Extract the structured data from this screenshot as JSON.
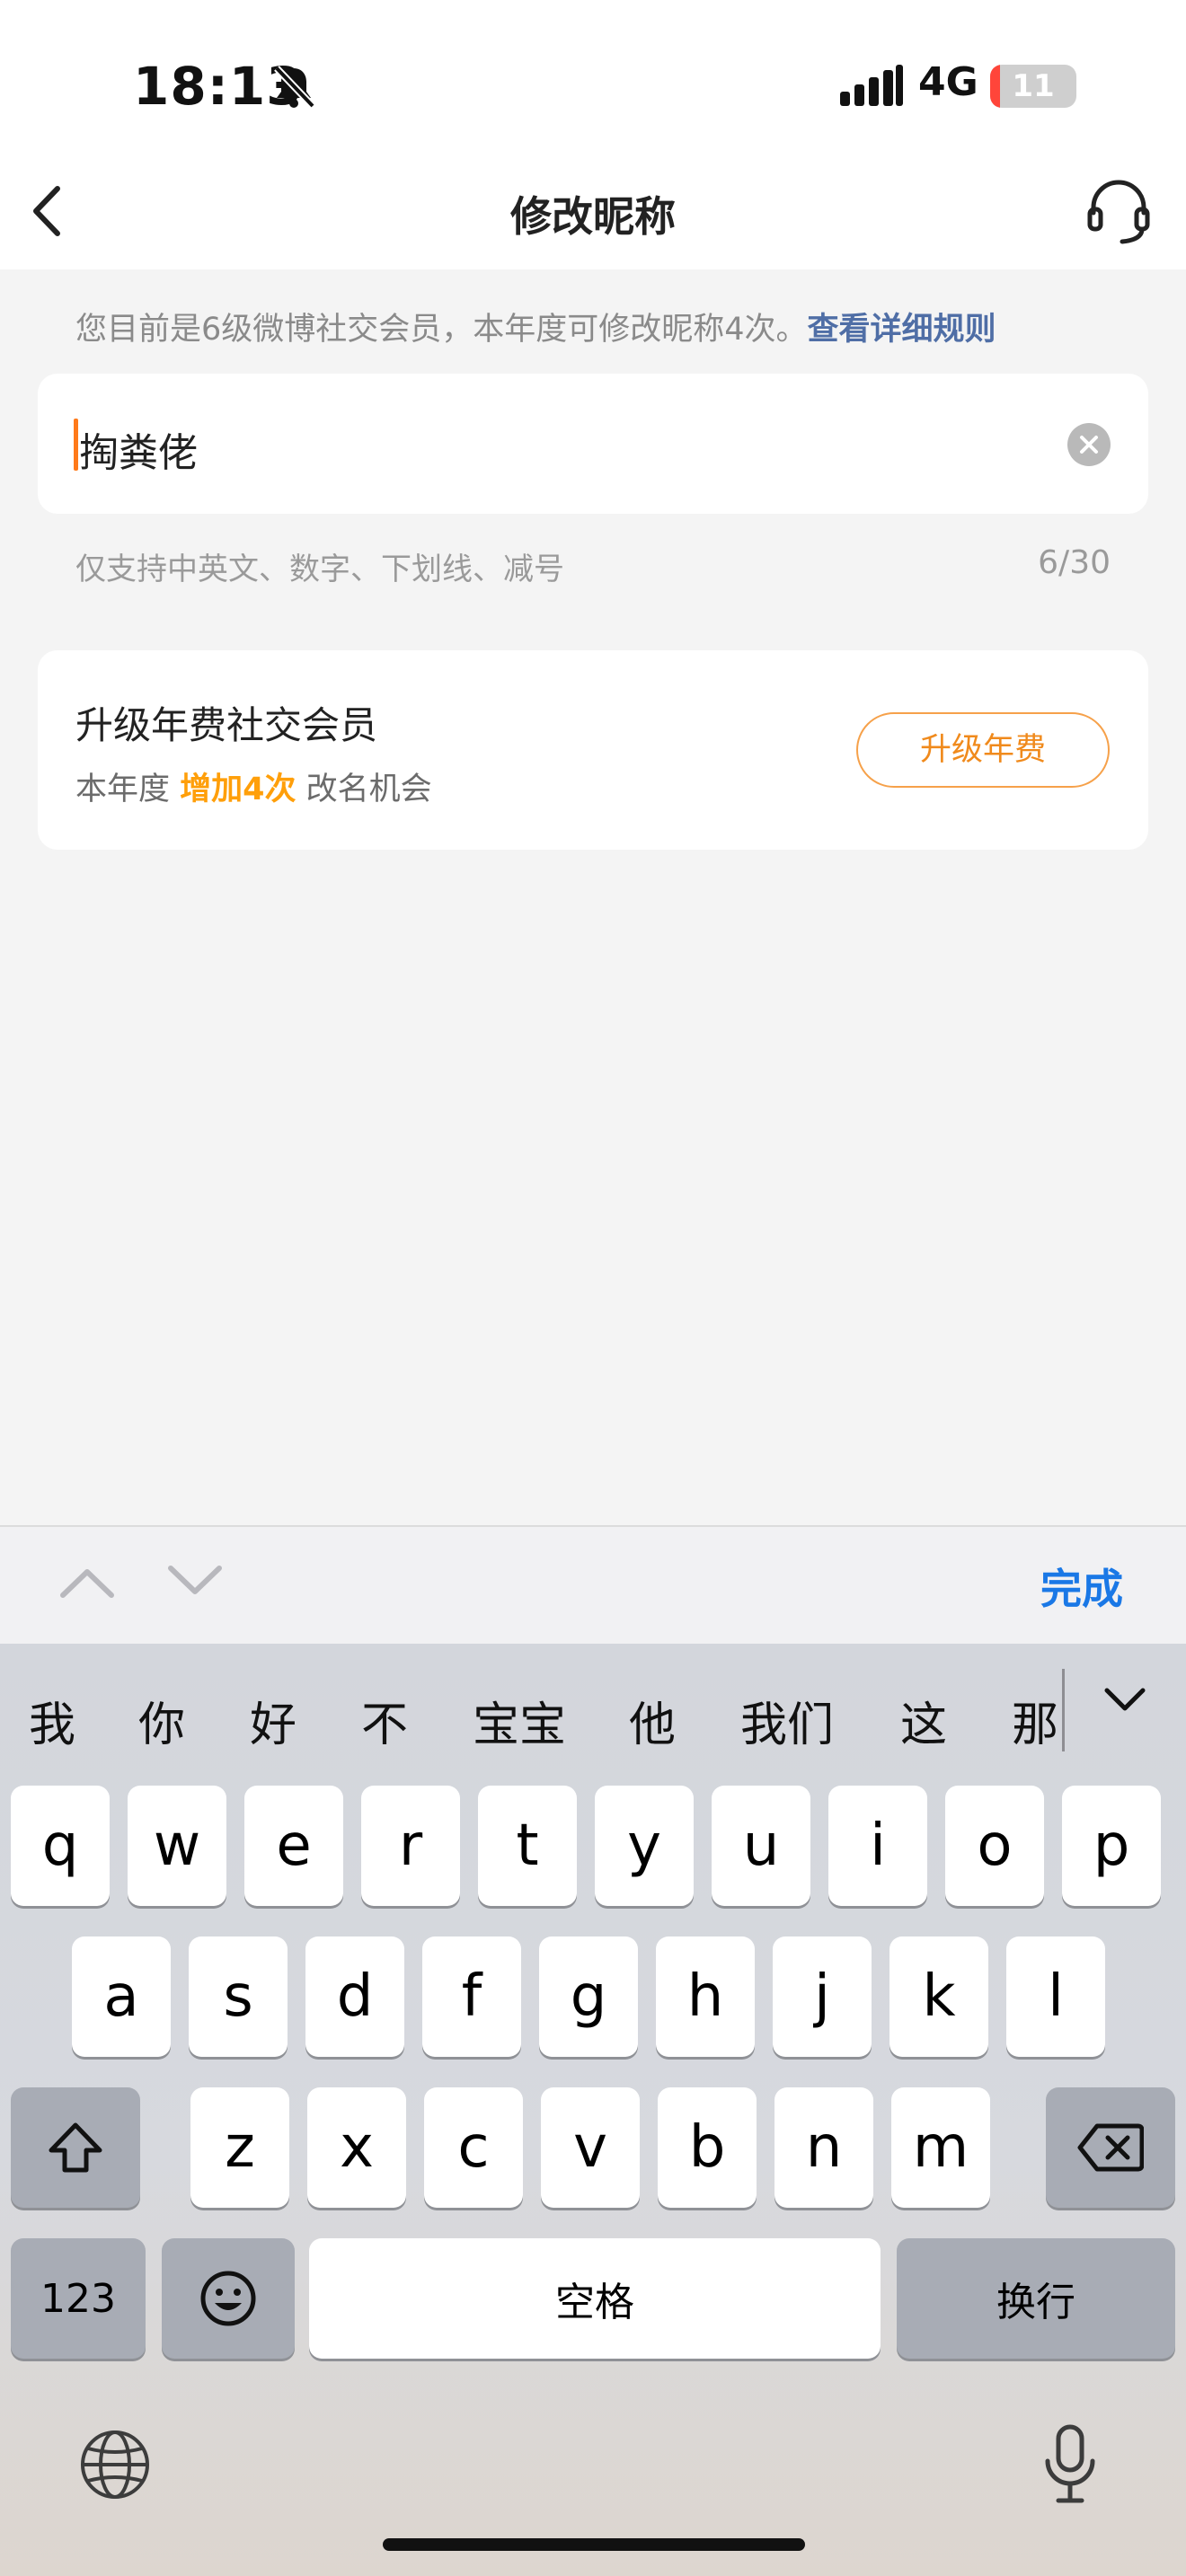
{
  "status_bar": {
    "time": "18:13",
    "network": "4G",
    "battery": "11",
    "battery_level_fraction": 0.11
  },
  "nav": {
    "title": "修改昵称"
  },
  "notice": {
    "text": "您目前是6级微博社交会员，本年度可修改昵称4次。",
    "link": "查看详细规则"
  },
  "input": {
    "value": "掏粪佬",
    "hint": "仅支持中英文、数字、下划线、减号",
    "counter": "6/30"
  },
  "upgrade": {
    "title": "升级年费社交会员",
    "sub_prefix": "本年度",
    "sub_highlight": "增加4次",
    "sub_suffix": "改名机会",
    "button": "升级年费"
  },
  "accessory": {
    "done": "完成"
  },
  "keyboard": {
    "candidates": [
      "我",
      "你",
      "好",
      "不",
      "宝宝",
      "他",
      "我们",
      "这",
      "那"
    ],
    "row1": [
      "q",
      "w",
      "e",
      "r",
      "t",
      "y",
      "u",
      "i",
      "o",
      "p"
    ],
    "row2": [
      "a",
      "s",
      "d",
      "f",
      "g",
      "h",
      "j",
      "k",
      "l"
    ],
    "row3": [
      "z",
      "x",
      "c",
      "v",
      "b",
      "n",
      "m"
    ],
    "numbers_key": "123",
    "space_key": "空格",
    "return_key": "换行"
  },
  "icons": {
    "back": "chevron-left-icon",
    "service": "headset-icon",
    "bell": "bell-slash-icon",
    "clear": "clear-circle-icon",
    "shift": "shift-icon",
    "delete": "backspace-icon",
    "emoji": "emoji-icon",
    "globe": "globe-icon",
    "mic": "microphone-icon"
  },
  "colors": {
    "accent_orange": "#ff9f0a",
    "link_blue": "#4f6ea6",
    "done_blue": "#1a78e6",
    "cursor": "#ff7a1a"
  }
}
